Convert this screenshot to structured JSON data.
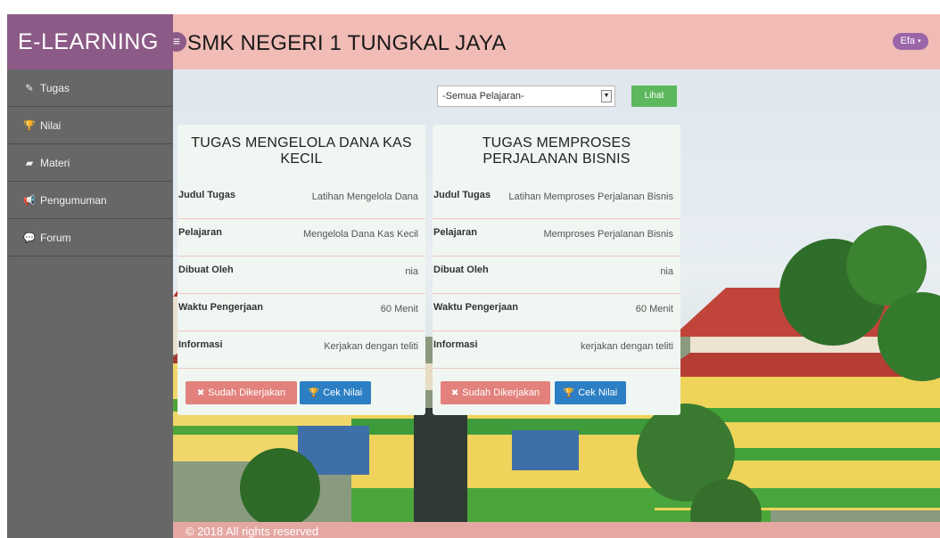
{
  "header": {
    "brand": "E-LEARNING",
    "menu_icon": "≡",
    "school": "SMK NEGERI 1 TUNGKAL JAYA",
    "user": "Efa",
    "user_caret": "▾"
  },
  "sidebar": {
    "items": [
      {
        "label": "Tugas",
        "icon": "pencil-icon",
        "glyph": "✎"
      },
      {
        "label": "Nilai",
        "icon": "trophy-icon",
        "glyph": "🏆"
      },
      {
        "label": "Materi",
        "icon": "book-icon",
        "glyph": "▰"
      },
      {
        "label": "Pengumuman",
        "icon": "megaphone-icon",
        "glyph": "📢"
      },
      {
        "label": "Forum",
        "icon": "chat-icon",
        "glyph": "💬"
      }
    ]
  },
  "filter": {
    "select_value": "-Semua Pelajaran-",
    "select_arrow": "▼",
    "button": "Lihat"
  },
  "cards": [
    {
      "title": "TUGAS MENGELOLA DANA KAS KECIL",
      "rows": [
        {
          "label": "Judul Tugas",
          "value": "Latihan Mengelola Dana"
        },
        {
          "label": "Pelajaran",
          "value": "Mengelola Dana Kas Kecil"
        },
        {
          "label": "Dibuat Oleh",
          "value": "nia"
        },
        {
          "label": "Waktu Pengerjaan",
          "value": "60 Menit"
        },
        {
          "label": "Informasi",
          "value": "Kerjakan dengan teliti"
        }
      ],
      "done_button": "Sudah Dikerjakan",
      "grade_button": "Cek Nilai"
    },
    {
      "title": "TUGAS MEMPROSES PERJALANAN BISNIS",
      "rows": [
        {
          "label": "Judul Tugas",
          "value": "Latihan Memproses Perjalanan Bisnis"
        },
        {
          "label": "Pelajaran",
          "value": "Memproses Perjalanan Bisnis"
        },
        {
          "label": "Dibuat Oleh",
          "value": "nia"
        },
        {
          "label": "Waktu Pengerjaan",
          "value": "60 Menit"
        },
        {
          "label": "Informasi",
          "value": "kerjakan dengan teliti"
        }
      ],
      "done_button": "Sudah Dikerjakan",
      "grade_button": "Cek Nilai"
    }
  ],
  "icons": {
    "done": "✖",
    "grade": "🏆"
  },
  "footer": {
    "text": "© 2018 All rights reserved"
  },
  "colors": {
    "brand_bg": "#8c5a86",
    "header_bg": "#f1bcb6",
    "success": "#5cb85c",
    "danger": "#e3817c",
    "primary": "#2c7fc4",
    "footer_bg": "#e5a7a2"
  }
}
